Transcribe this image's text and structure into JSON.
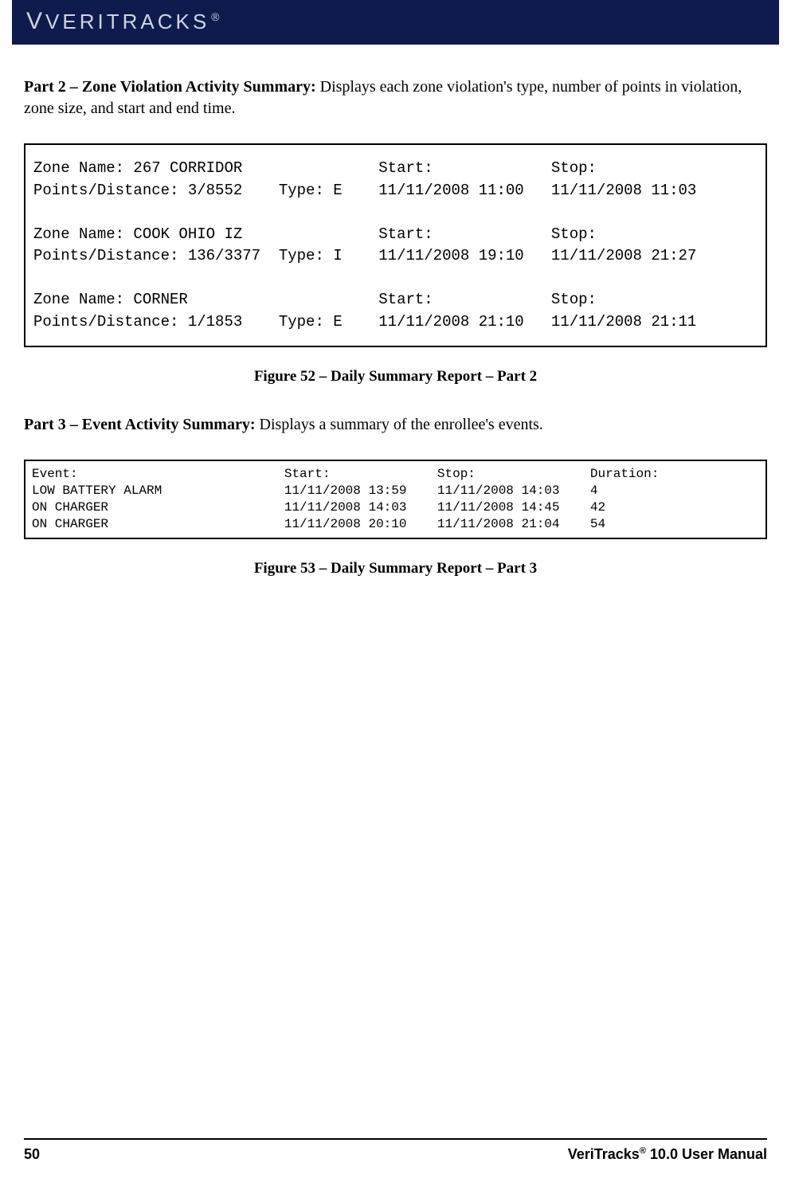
{
  "brand": {
    "text": "VERITRACKS",
    "reg": "®"
  },
  "part2": {
    "title": "Part 2 – Zone Violation Activity Summary:",
    "desc": " Displays each zone violation's type, number of points in violation, zone size, and start and end time."
  },
  "fig52": {
    "labels": {
      "zoneName": "Zone Name:",
      "pointsDistance": "Points/Distance:",
      "type": "Type:",
      "start": "Start:",
      "stop": "Stop:"
    },
    "rows": [
      {
        "zone": "267 CORRIDOR",
        "pd": "3/8552",
        "type": "E",
        "start": "11/11/2008 11:00",
        "stop": "11/11/2008 11:03"
      },
      {
        "zone": "COOK OHIO IZ",
        "pd": "136/3377",
        "type": "I",
        "start": "11/11/2008 19:10",
        "stop": "11/11/2008 21:27"
      },
      {
        "zone": "CORNER",
        "pd": "1/1853",
        "type": "E",
        "start": "11/11/2008 21:10",
        "stop": "11/11/2008 21:11"
      }
    ]
  },
  "caption52": "Figure 52 – Daily Summary Report – Part 2",
  "part3": {
    "title": "Part 3 – Event Activity Summary:",
    "desc": " Displays a summary of the enrollee's events."
  },
  "fig53": {
    "labels": {
      "event": "Event:",
      "start": "Start:",
      "stop": "Stop:",
      "duration": "Duration:"
    },
    "rows": [
      {
        "event": "LOW BATTERY ALARM",
        "start": "11/11/2008 13:59",
        "stop": "11/11/2008 14:03",
        "duration": "4"
      },
      {
        "event": "ON CHARGER",
        "start": "11/11/2008 14:03",
        "stop": "11/11/2008 14:45",
        "duration": "42"
      },
      {
        "event": "ON CHARGER",
        "start": "11/11/2008 20:10",
        "stop": "11/11/2008 21:04",
        "duration": "54"
      }
    ]
  },
  "caption53": "Figure 53 – Daily Summary Report – Part 3",
  "footer": {
    "pageNum": "50",
    "product": "VeriTracks",
    "reg": "®",
    "manual": " 10.0 User Manual"
  }
}
